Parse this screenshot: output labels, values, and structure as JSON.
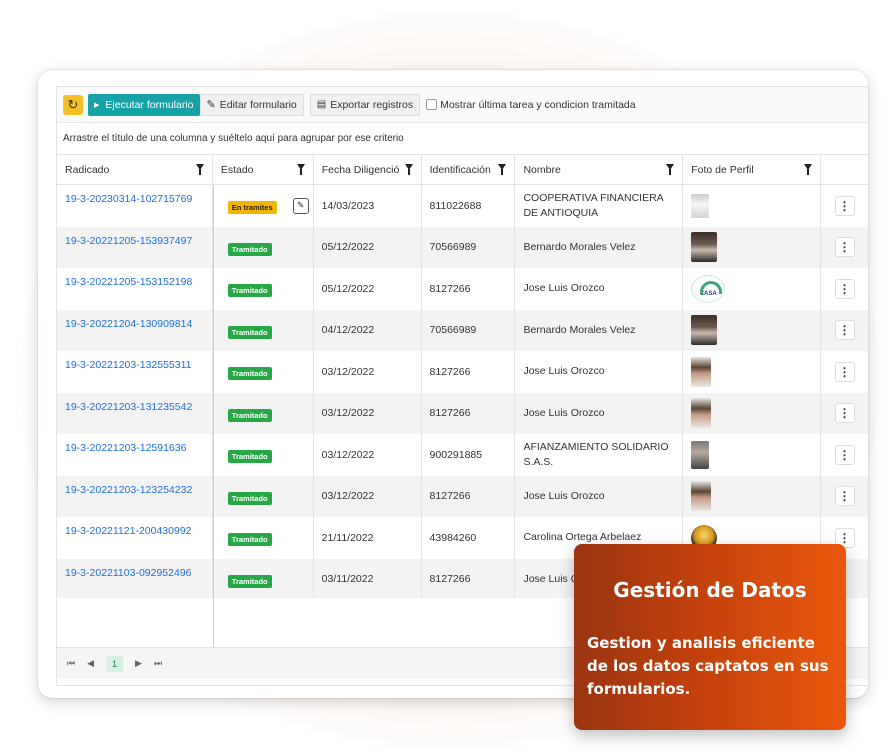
{
  "toolbar": {
    "run_label": "Ejecutar formulario",
    "edit_label": "Editar formulario",
    "export_label": "Exportar registros",
    "checkbox_label": "Mostrar última tarea y condicion tramitada"
  },
  "group_hint": "Arrastre el título de una columna y suéltelo aquí para agrupar por ese criterio",
  "columns": [
    "Radicado",
    "Estado",
    "Fecha Diligenció",
    "Identificación",
    "Nombre",
    "Foto de Perfil"
  ],
  "rows": [
    {
      "radicado": "19-3-20230314-102715769",
      "estado": "En tramites",
      "fecha": "14/03/2023",
      "id": "811022688",
      "nombre": "COOPERATIVA FINANCIERA DE ANTIOQUIA",
      "photo": "document"
    },
    {
      "radicado": "19-3-20221205-153937497",
      "estado": "Tramitado",
      "fecha": "05/12/2022",
      "id": "70566989",
      "nombre": "Bernardo Morales Velez",
      "photo": "man"
    },
    {
      "radicado": "19-3-20221205-153152198",
      "estado": "Tramitado",
      "fecha": "05/12/2022",
      "id": "8127266",
      "nombre": "Jose Luis Orozco",
      "photo": "logo"
    },
    {
      "radicado": "19-3-20221204-130909814",
      "estado": "Tramitado",
      "fecha": "04/12/2022",
      "id": "70566989",
      "nombre": "Bernardo Morales Velez",
      "photo": "man"
    },
    {
      "radicado": "19-3-20221203-132555311",
      "estado": "Tramitado",
      "fecha": "03/12/2022",
      "id": "8127266",
      "nombre": "Jose Luis Orozco",
      "photo": "woman"
    },
    {
      "radicado": "19-3-20221203-131235542",
      "estado": "Tramitado",
      "fecha": "03/12/2022",
      "id": "8127266",
      "nombre": "Jose Luis Orozco",
      "photo": "woman"
    },
    {
      "radicado": "19-3-20221203-12591636",
      "estado": "Tramitado",
      "fecha": "03/12/2022",
      "id": "900291885",
      "nombre": "AFIANZAMIENTO SOLIDARIO S.A.S.",
      "photo": "group"
    },
    {
      "radicado": "19-3-20221203-123254232",
      "estado": "Tramitado",
      "fecha": "03/12/2022",
      "id": "8127266",
      "nombre": "Jose Luis Orozco",
      "photo": "woman"
    },
    {
      "radicado": "19-3-20221121-200430992",
      "estado": "Tramitado",
      "fecha": "21/11/2022",
      "id": "43984260",
      "nombre": "Carolina Ortega Arbelaez",
      "photo": "bulb"
    },
    {
      "radicado": "19-3-20221103-092952496",
      "estado": "Tramitado",
      "fecha": "03/11/2022",
      "id": "8127266",
      "nombre": "Jose Luis Orozco",
      "photo": "none"
    }
  ],
  "logo_text": "CASA",
  "pager": {
    "first": "⏮",
    "prev": "◀",
    "page": "1",
    "next": "▶",
    "last": "⏭"
  },
  "promo": {
    "title": "Gestión de Datos",
    "description": "Gestion y analisis eficiente de los datos captatos en sus formularios."
  },
  "colors": {
    "accent": "#17a2a8",
    "success": "#28a745",
    "warning": "#f2b600",
    "link": "#1e6fd9",
    "promo": "#c2410c"
  }
}
